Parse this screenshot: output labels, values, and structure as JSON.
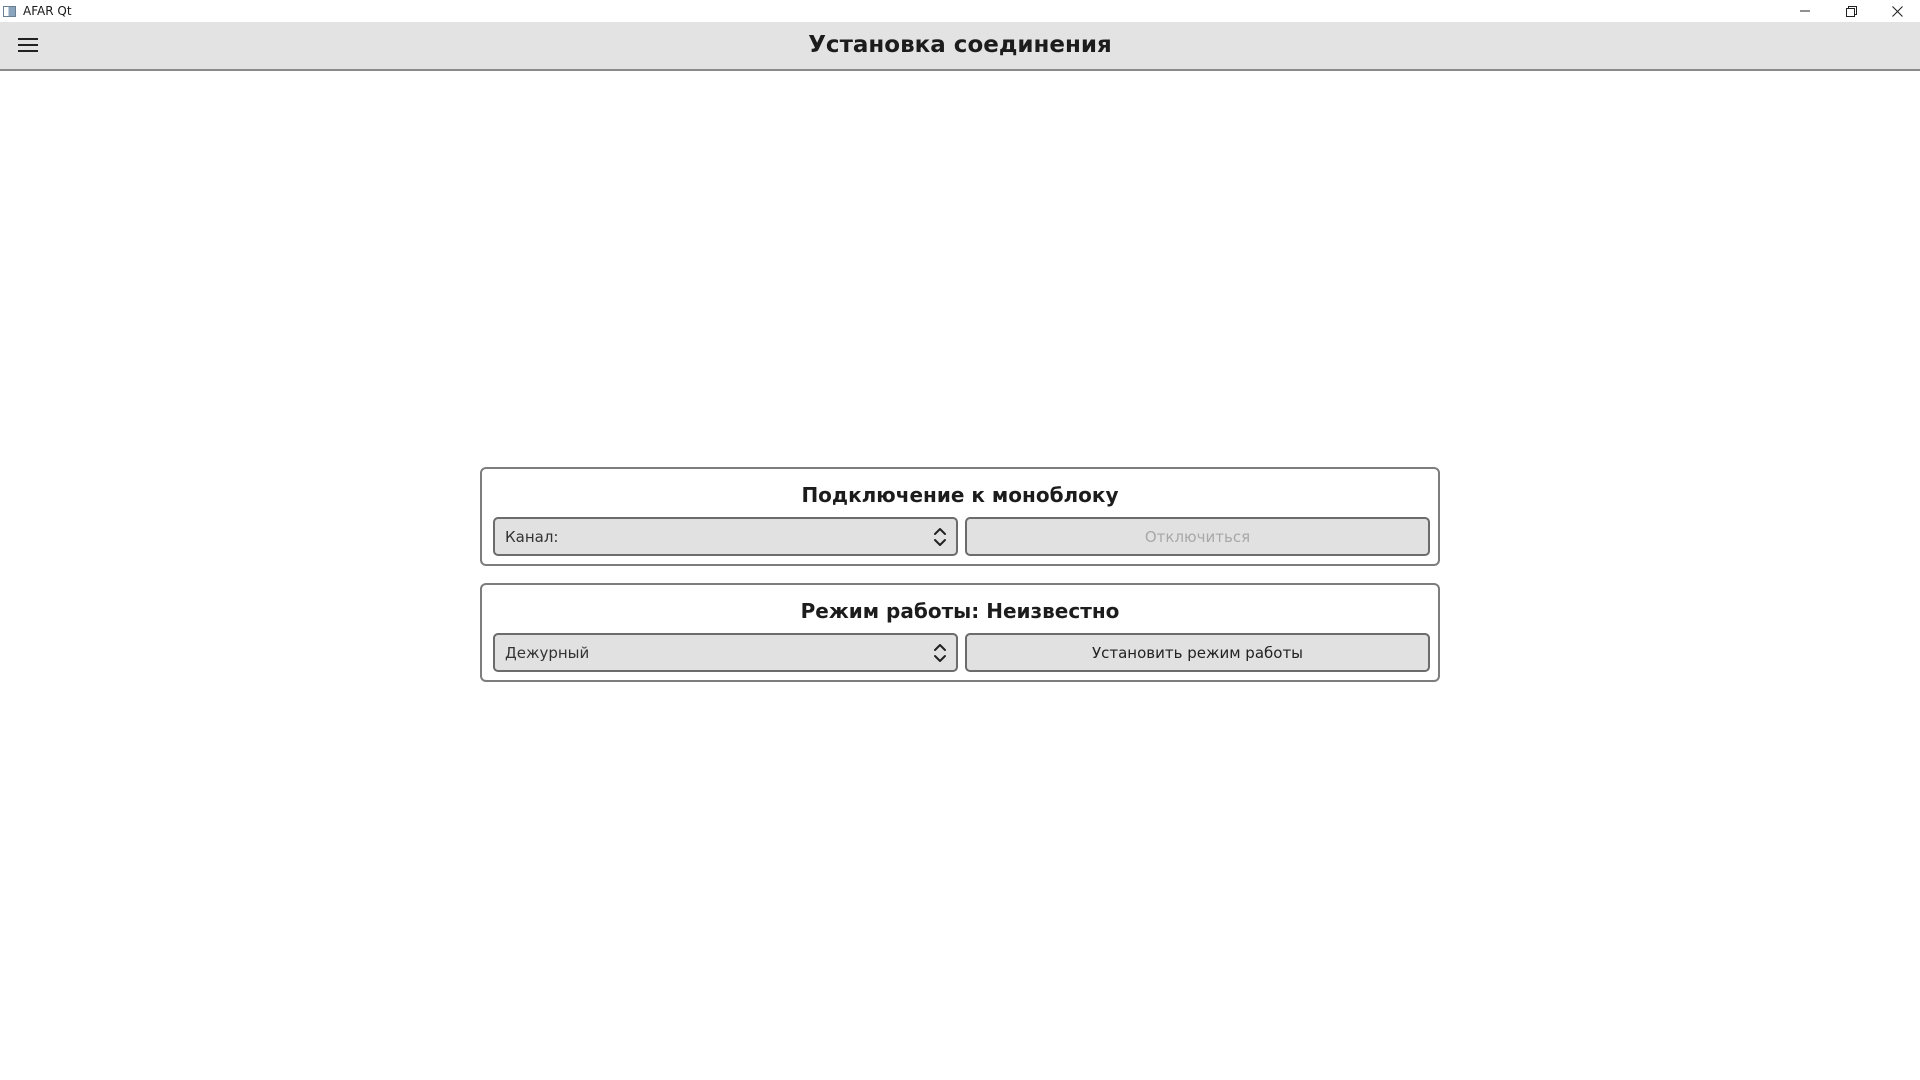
{
  "window": {
    "title": "AFAR Qt",
    "icon": "app-window-icon",
    "controls": [
      "minimize-icon",
      "restore-icon",
      "close-icon"
    ]
  },
  "header": {
    "title": "Установка соединения",
    "menu_icon": "hamburger-menu-icon"
  },
  "connection": {
    "title": "Подключение к моноблоку",
    "channel_value": "Канал:",
    "disconnect_label": "Отключиться",
    "disconnect_enabled": false
  },
  "mode": {
    "title": "Режим работы: Неизвестно",
    "selected_mode": "Дежурный",
    "set_mode_label": "Установить режим работы"
  },
  "colors": {
    "header_bg": "#e3e3e3",
    "control_bg": "#e1e1e1",
    "border": "#6c6c6c",
    "disabled_text": "#a8a8a8"
  }
}
